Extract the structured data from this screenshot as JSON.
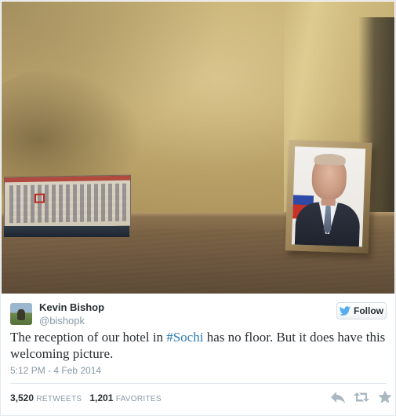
{
  "photo": {
    "subject": "hotel-room-shelf-with-calendar-and-framed-portrait"
  },
  "author": {
    "name": "Kevin Bishop",
    "handle": "@bishopk"
  },
  "follow": {
    "label": "Follow"
  },
  "tweet": {
    "text_before": "The reception of our hotel in ",
    "hashtag": "#Sochi",
    "text_after": " has no floor. But it does have this welcoming picture.",
    "timestamp": "5:12 PM - 4 Feb 2014"
  },
  "stats": {
    "retweets_count": "3,520",
    "retweets_label": "RETWEETS",
    "favorites_count": "1,201",
    "favorites_label": "FAVORITES"
  },
  "icons": {
    "follow": "bird-icon",
    "reply": "reply-icon",
    "retweet": "retweet-icon",
    "favorite": "star-icon"
  },
  "colors": {
    "link": "#2b7bb9",
    "muted": "#8899a6",
    "text": "#292f33",
    "icon": "#aab8c2",
    "bird": "#55acee"
  }
}
